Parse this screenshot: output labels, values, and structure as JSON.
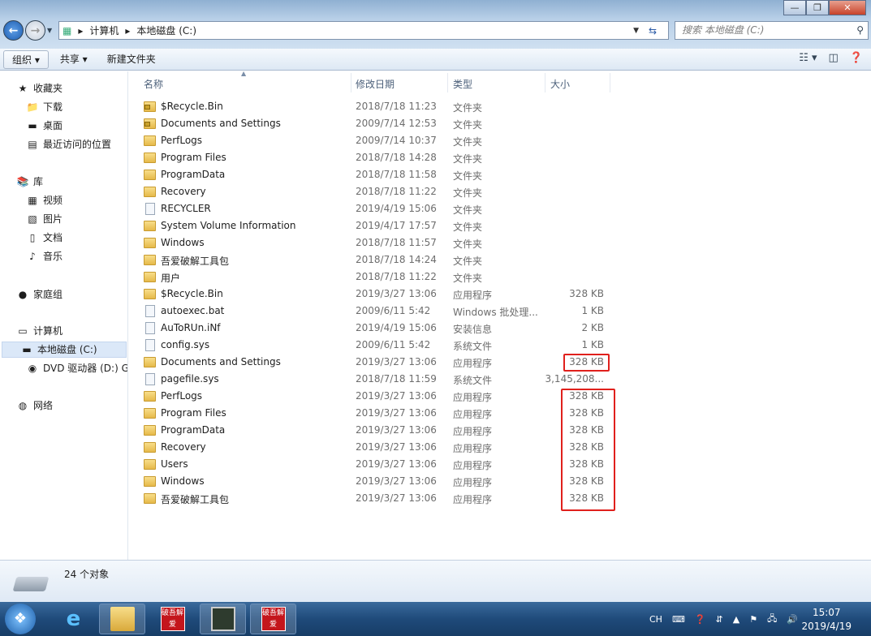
{
  "window": {
    "minimize": "—",
    "maximize": "❐",
    "close": "✕"
  },
  "address": {
    "crumbs": [
      "计算机",
      "本地磁盘 (C:)"
    ],
    "separator": "▸"
  },
  "search": {
    "placeholder": "搜索 本地磁盘 (C:)"
  },
  "toolbar": {
    "organize": "组织 ▾",
    "share": "共享 ▾",
    "new_folder": "新建文件夹"
  },
  "sidebar": {
    "items": [
      {
        "label": "收藏夹",
        "icon": "★"
      },
      {
        "label": "下载",
        "icon": "📁"
      },
      {
        "label": "桌面",
        "icon": "▬"
      },
      {
        "label": "最近访问的位置",
        "icon": "▤"
      },
      {
        "label": "库",
        "icon": "📚"
      },
      {
        "label": "视频",
        "icon": "▦"
      },
      {
        "label": "图片",
        "icon": "▧"
      },
      {
        "label": "文档",
        "icon": "▯"
      },
      {
        "label": "音乐",
        "icon": "♪"
      },
      {
        "label": "家庭组",
        "icon": "●"
      },
      {
        "label": "计算机",
        "icon": "▭"
      },
      {
        "label": "本地磁盘 (C:)",
        "icon": "▬"
      },
      {
        "label": "DVD 驱动器 (D:) GF",
        "icon": "◉"
      },
      {
        "label": "网络",
        "icon": "◍"
      }
    ]
  },
  "columns": {
    "name": "名称",
    "date": "修改日期",
    "type": "类型",
    "size": "大小"
  },
  "files": [
    {
      "name": "$Recycle.Bin",
      "date": "2018/7/18 11:23",
      "type": "文件夹",
      "size": "",
      "kind": "folder",
      "locked": true
    },
    {
      "name": "Documents and Settings",
      "date": "2009/7/14 12:53",
      "type": "文件夹",
      "size": "",
      "kind": "folder",
      "locked": true
    },
    {
      "name": "PerfLogs",
      "date": "2009/7/14 10:37",
      "type": "文件夹",
      "size": "",
      "kind": "folder"
    },
    {
      "name": "Program Files",
      "date": "2018/7/18 14:28",
      "type": "文件夹",
      "size": "",
      "kind": "folder"
    },
    {
      "name": "ProgramData",
      "date": "2018/7/18 11:58",
      "type": "文件夹",
      "size": "",
      "kind": "folder"
    },
    {
      "name": "Recovery",
      "date": "2018/7/18 11:22",
      "type": "文件夹",
      "size": "",
      "kind": "folder"
    },
    {
      "name": "RECYCLER",
      "date": "2019/4/19 15:06",
      "type": "文件夹",
      "size": "",
      "kind": "file"
    },
    {
      "name": "System Volume Information",
      "date": "2019/4/17 17:57",
      "type": "文件夹",
      "size": "",
      "kind": "folder"
    },
    {
      "name": "Windows",
      "date": "2018/7/18 11:57",
      "type": "文件夹",
      "size": "",
      "kind": "folder"
    },
    {
      "name": "吾爱破解工具包",
      "date": "2018/7/18 14:24",
      "type": "文件夹",
      "size": "",
      "kind": "folder"
    },
    {
      "name": "用户",
      "date": "2018/7/18 11:22",
      "type": "文件夹",
      "size": "",
      "kind": "folder"
    },
    {
      "name": "$Recycle.Bin",
      "date": "2019/3/27 13:06",
      "type": "应用程序",
      "size": "328 KB",
      "kind": "folder"
    },
    {
      "name": "autoexec.bat",
      "date": "2009/6/11 5:42",
      "type": "Windows 批处理...",
      "size": "1 KB",
      "kind": "file"
    },
    {
      "name": "AuToRUn.iNf",
      "date": "2019/4/19 15:06",
      "type": "安装信息",
      "size": "2 KB",
      "kind": "file"
    },
    {
      "name": "config.sys",
      "date": "2009/6/11 5:42",
      "type": "系统文件",
      "size": "1 KB",
      "kind": "file"
    },
    {
      "name": "Documents and Settings",
      "date": "2019/3/27 13:06",
      "type": "应用程序",
      "size": "328 KB",
      "kind": "folder"
    },
    {
      "name": "pagefile.sys",
      "date": "2018/7/18 11:59",
      "type": "系统文件",
      "size": "3,145,208...",
      "kind": "file"
    },
    {
      "name": "PerfLogs",
      "date": "2019/3/27 13:06",
      "type": "应用程序",
      "size": "328 KB",
      "kind": "folder"
    },
    {
      "name": "Program Files",
      "date": "2019/3/27 13:06",
      "type": "应用程序",
      "size": "328 KB",
      "kind": "folder"
    },
    {
      "name": "ProgramData",
      "date": "2019/3/27 13:06",
      "type": "应用程序",
      "size": "328 KB",
      "kind": "folder"
    },
    {
      "name": "Recovery",
      "date": "2019/3/27 13:06",
      "type": "应用程序",
      "size": "328 KB",
      "kind": "folder"
    },
    {
      "name": "Users",
      "date": "2019/3/27 13:06",
      "type": "应用程序",
      "size": "328 KB",
      "kind": "folder"
    },
    {
      "name": "Windows",
      "date": "2019/3/27 13:06",
      "type": "应用程序",
      "size": "328 KB",
      "kind": "folder"
    },
    {
      "name": "吾爱破解工具包",
      "date": "2019/3/27 13:06",
      "type": "应用程序",
      "size": "328 KB",
      "kind": "folder"
    }
  ],
  "status": {
    "count": "24 个对象"
  },
  "taskbar": {
    "pojie": "破吾解爱",
    "lang": "CH",
    "time": "15:07",
    "date": "2019/4/19"
  },
  "colors": {
    "highlight": "#e0201c"
  }
}
